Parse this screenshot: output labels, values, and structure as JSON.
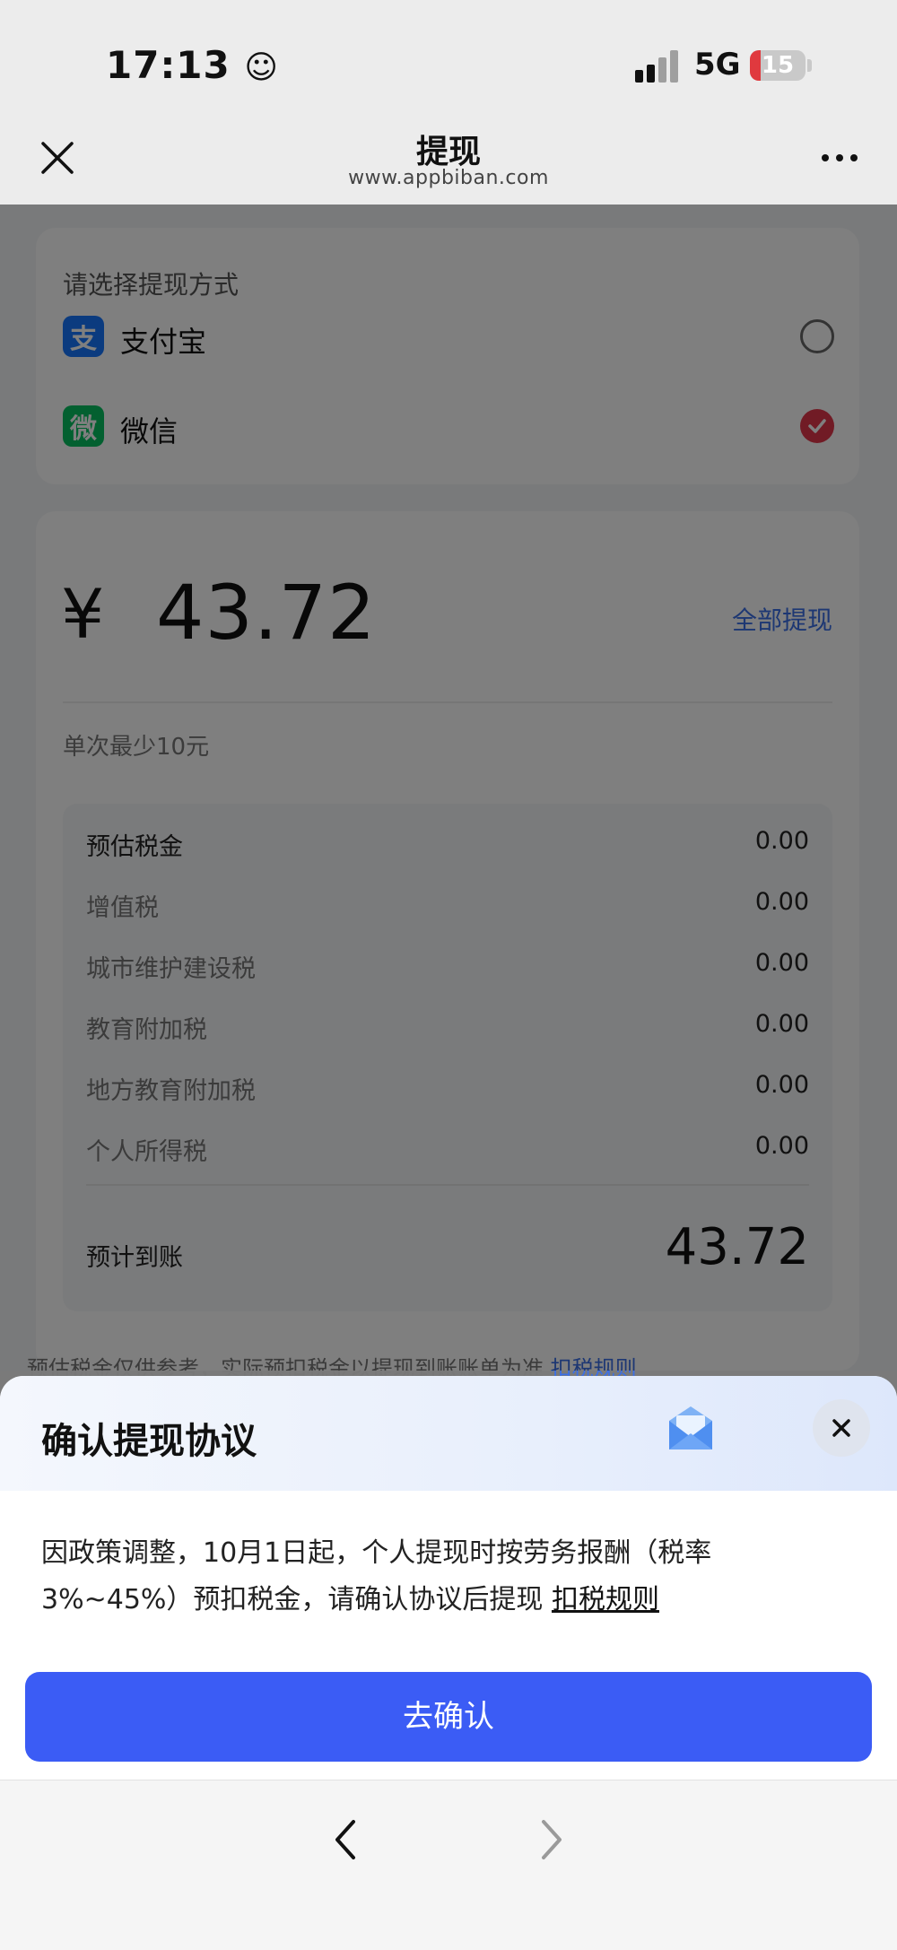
{
  "status_bar": {
    "time": "17:13",
    "network": "5G",
    "battery": "15"
  },
  "nav": {
    "title": "提现",
    "url": "www.appbiban.com"
  },
  "withdraw_method": {
    "heading": "请选择提现方式",
    "options": [
      {
        "label": "支付宝",
        "logo": "支",
        "selected": false
      },
      {
        "label": "微信",
        "logo": "微",
        "selected": true
      }
    ]
  },
  "amount_section": {
    "currency": "¥",
    "amount": "43.72",
    "withdraw_all": "全部提现",
    "min_note": "单次最少10元"
  },
  "tax": {
    "rows": [
      {
        "name": "预估税金",
        "value": "0.00"
      },
      {
        "name": "增值税",
        "value": "0.00"
      },
      {
        "name": "城市维护建设税",
        "value": "0.00"
      },
      {
        "name": "教育附加税",
        "value": "0.00"
      },
      {
        "name": "地方教育附加税",
        "value": "0.00"
      },
      {
        "name": "个人所得税",
        "value": "0.00"
      }
    ],
    "arrival_label": "预计到账",
    "arrival_value": "43.72"
  },
  "footnote": {
    "text": "预估税金仅供参考，实际预扣税金以提现到账账单为准",
    "link": "扣税规则"
  },
  "sheet": {
    "title": "确认提现协议",
    "body": "因政策调整，10月1日起，个人提现时按劳务报酬（税率3%~45%）预扣税金，请确认协议后提现",
    "link": "扣税规则",
    "confirm_label": "去确认"
  },
  "colors": {
    "accent": "#3b5cf5",
    "link": "#3b6fe6",
    "check": "#e2364a",
    "alipay": "#1677ff",
    "wechat": "#07c160"
  }
}
